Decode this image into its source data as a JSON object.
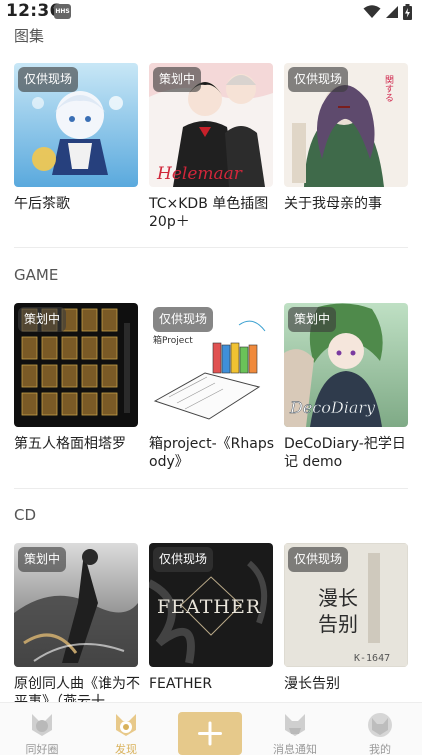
{
  "status": {
    "time": "12:36",
    "badge": "HHS"
  },
  "sections": [
    {
      "title": "图集",
      "cards": [
        {
          "tag": "仅供现场",
          "title": "午后茶歌"
        },
        {
          "tag": "策划中",
          "title": "TC×KDB 单色插图20p＋"
        },
        {
          "tag": "仅供现场",
          "title": "关于我母亲的事"
        }
      ]
    },
    {
      "title": "GAME",
      "cards": [
        {
          "tag": "策划中",
          "title": "第五人格面相塔罗"
        },
        {
          "tag": "仅供现场",
          "title": "箱project-《Rhapsody》"
        },
        {
          "tag": "策划中",
          "title": "DeCoDiary-祀学日记 demo"
        }
      ]
    },
    {
      "title": "CD",
      "cards": [
        {
          "tag": "策划中",
          "title": "原创同人曲《谁为不平事》（燕云十"
        },
        {
          "tag": "仅供现场",
          "title": "FEATHER"
        },
        {
          "tag": "仅供现场",
          "title": "漫长告别"
        }
      ]
    }
  ],
  "artwork_text": {
    "helemaar": "Helemaar",
    "project": "箱Project",
    "decodiary": "DecoDiary",
    "feather": "FEATHER",
    "farewell_1": "漫长",
    "farewell_2": "告别",
    "farewell_code": "K-1647",
    "kanji": "関する"
  },
  "nav": [
    {
      "label": "同好圈",
      "icon": "fox-icon",
      "active": false
    },
    {
      "label": "发现",
      "icon": "fox-icon",
      "active": true
    },
    {
      "label": "",
      "icon": "plus-icon",
      "active": false
    },
    {
      "label": "消息通知",
      "icon": "fox-icon",
      "active": false
    },
    {
      "label": "我的",
      "icon": "fox-face-icon",
      "active": false
    }
  ],
  "colors": {
    "accent": "#e6c98b",
    "active_label": "#d9b25c",
    "tag_bg": "rgba(60,60,60,0.62)"
  }
}
